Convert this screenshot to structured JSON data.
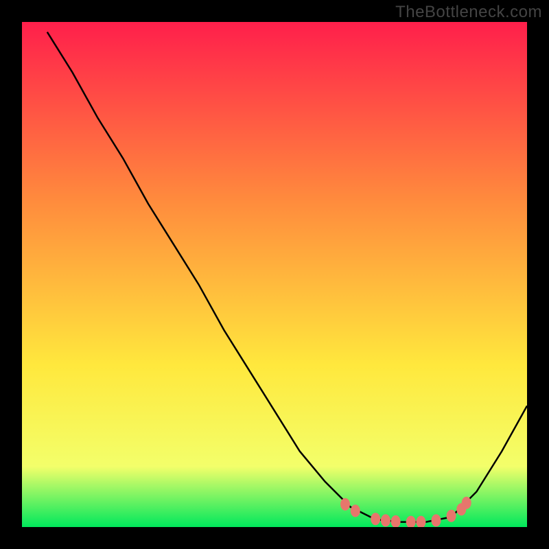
{
  "watermark": "TheBottleneck.com",
  "colors": {
    "gradient_top": "#ff1f4b",
    "gradient_mid1": "#ff8a3d",
    "gradient_mid2": "#ffe83d",
    "gradient_mid3": "#f3ff6a",
    "gradient_bottom": "#00e85c",
    "curve": "#000000",
    "dots": "#e7766c",
    "frame": "#000000"
  },
  "chart_data": {
    "type": "line",
    "title": "",
    "xlabel": "",
    "ylabel": "",
    "x_range": [
      0,
      100
    ],
    "y_range": [
      0,
      100
    ],
    "curve": [
      {
        "x": 5,
        "y": 98
      },
      {
        "x": 10,
        "y": 90
      },
      {
        "x": 15,
        "y": 81
      },
      {
        "x": 20,
        "y": 73
      },
      {
        "x": 25,
        "y": 64
      },
      {
        "x": 30,
        "y": 56
      },
      {
        "x": 35,
        "y": 48
      },
      {
        "x": 40,
        "y": 39
      },
      {
        "x": 45,
        "y": 31
      },
      {
        "x": 50,
        "y": 23
      },
      {
        "x": 55,
        "y": 15
      },
      {
        "x": 60,
        "y": 9
      },
      {
        "x": 65,
        "y": 4
      },
      {
        "x": 70,
        "y": 1.5
      },
      {
        "x": 75,
        "y": 1
      },
      {
        "x": 80,
        "y": 1
      },
      {
        "x": 85,
        "y": 2
      },
      {
        "x": 90,
        "y": 7
      },
      {
        "x": 95,
        "y": 15
      },
      {
        "x": 100,
        "y": 24
      }
    ],
    "dots": [
      {
        "x": 64,
        "y": 4.5
      },
      {
        "x": 66,
        "y": 3.2
      },
      {
        "x": 70,
        "y": 1.6
      },
      {
        "x": 72,
        "y": 1.3
      },
      {
        "x": 74,
        "y": 1.1
      },
      {
        "x": 77,
        "y": 1.0
      },
      {
        "x": 79,
        "y": 1.0
      },
      {
        "x": 82,
        "y": 1.3
      },
      {
        "x": 85,
        "y": 2.2
      },
      {
        "x": 87,
        "y": 3.5
      },
      {
        "x": 88,
        "y": 4.8
      }
    ]
  }
}
